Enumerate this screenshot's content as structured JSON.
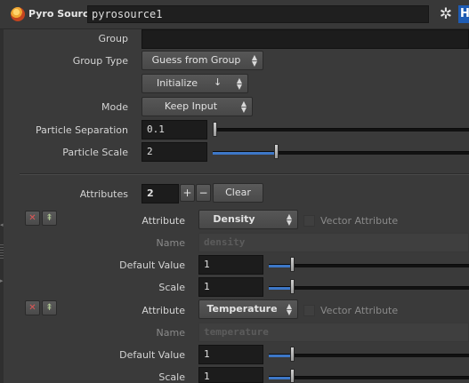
{
  "header": {
    "node_type": "Pyro Source",
    "node_name": "pyrosource1",
    "help_label": "H",
    "node_icon": "pyro-source-icon",
    "gear_icon": "gear-icon"
  },
  "params": {
    "group_label": "Group",
    "group_value": "",
    "group_type_label": "Group Type",
    "group_type_value": "Guess from Group",
    "initialize_value": "Initialize",
    "mode_label": "Mode",
    "mode_value": "Keep Input",
    "particle_sep_label": "Particle Separation",
    "particle_sep_value": "0.1",
    "particle_scale_label": "Particle Scale",
    "particle_scale_value": "2"
  },
  "attributes": {
    "label": "Attributes",
    "count": "2",
    "add": "+",
    "remove": "−",
    "clear": "Clear",
    "items": [
      {
        "attribute_label": "Attribute",
        "attribute_value": "Density",
        "vector_label": "Vector Attribute",
        "name_label": "Name",
        "name_value": "density",
        "default_label": "Default Value",
        "default_value": "1",
        "scale_label": "Scale",
        "scale_value": "1"
      },
      {
        "attribute_label": "Attribute",
        "attribute_value": "Temperature",
        "vector_label": "Vector Attribute",
        "name_label": "Name",
        "name_value": "temperature",
        "default_label": "Default Value",
        "default_value": "1",
        "scale_label": "Scale",
        "scale_value": "1"
      }
    ]
  },
  "sliders": {
    "particle_sep_fill": 0.0,
    "particle_scale_fill": 0.25
  },
  "colors": {
    "accent": "#3d77c7",
    "help_button": "#1e5cb4",
    "remove_icon": "#e05757"
  }
}
